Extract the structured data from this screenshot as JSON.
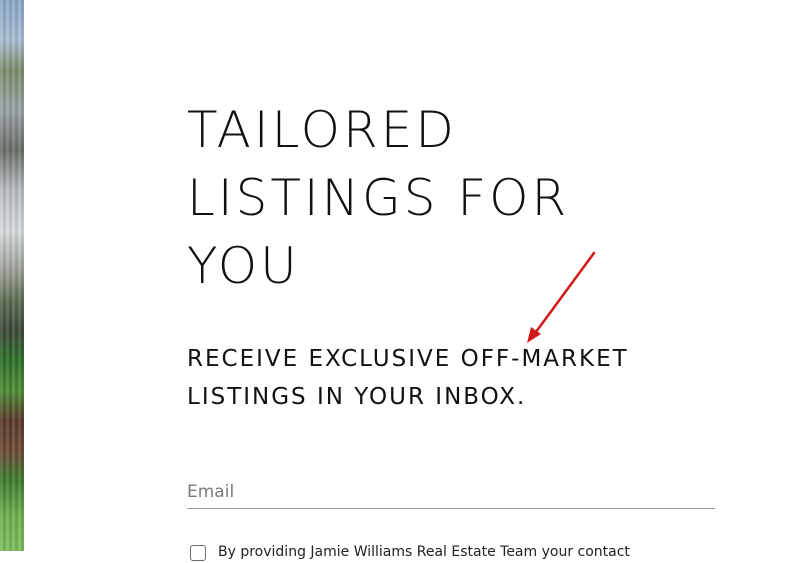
{
  "hero": {
    "title": "TAILORED LISTINGS FOR YOU",
    "subtitle": "RECEIVE EXCLUSIVE OFF-MARKET LISTINGS IN YOUR INBOX."
  },
  "form": {
    "email_placeholder": "Email",
    "consent_text": "By providing Jamie Williams Real Estate Team your contact"
  },
  "colors": {
    "text": "#111111",
    "annotation_arrow": "#d01818"
  }
}
